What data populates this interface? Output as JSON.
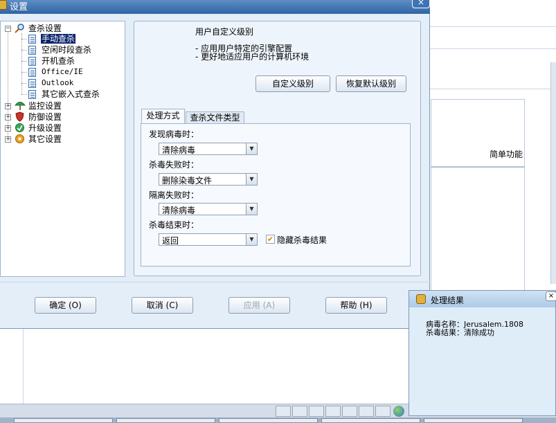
{
  "background_app": {
    "simple_function_label": "简单功能"
  },
  "dialog": {
    "title": "设置",
    "close_label": "×",
    "tree": [
      {
        "label": "查杀设置",
        "expander": "⊟",
        "children": [
          "手动查杀",
          "空闲时段查杀",
          "开机查杀",
          "Office/IE",
          "Outlook",
          "其它嵌入式查杀"
        ],
        "selected": "手动查杀"
      },
      {
        "label": "监控设置",
        "expander": "+"
      },
      {
        "label": "防御设置",
        "expander": "+"
      },
      {
        "label": "升级设置",
        "expander": "+"
      },
      {
        "label": "其它设置",
        "expander": "+"
      }
    ],
    "content": {
      "level_title": "用户自定义级别",
      "level_desc": [
        "- 应用用户特定的引擎配置",
        "- 更好地适应用户的计算机环境"
      ],
      "custom_level_button": "自定义级别",
      "restore_default_button": "恢复默认级别",
      "tabs": [
        "处理方式",
        "查杀文件类型"
      ],
      "fields": [
        {
          "label": "发现病毒时：",
          "value": "清除病毒"
        },
        {
          "label": "杀毒失败时：",
          "value": "删除染毒文件"
        },
        {
          "label": "隔离失败时：",
          "value": "清除病毒"
        },
        {
          "label": "杀毒结束时：",
          "value": "返回"
        }
      ],
      "hide_result_label": "隐藏杀毒结果",
      "hide_result_checked": true
    },
    "footer": {
      "ok": "确定 (O)",
      "cancel": "取消 (C)",
      "apply": "应用 (A)",
      "help": "帮助 (H)"
    }
  },
  "popup": {
    "title": "处理结果",
    "close_label": "×",
    "lines": [
      "病毒名称：Jerusalem.1808",
      "杀毒结果：清除成功"
    ]
  },
  "colors": {
    "title_bar": "#2f64a3",
    "dialog_bg": "#e4eef8",
    "selection": "#0a246a",
    "popup_bg": "#dfedf9"
  }
}
